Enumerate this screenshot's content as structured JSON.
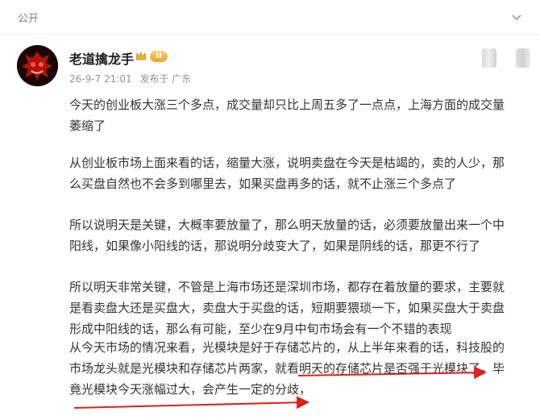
{
  "header": {
    "visibility_label": "公开",
    "menu_icon": "chevron-down-icon"
  },
  "post": {
    "author": {
      "name": "老道擒龙手",
      "badge_level": "II",
      "avatar_icon": "red-dragon-avatar"
    },
    "timestamp": "26-9-7 21:01",
    "location": "发布于 广东",
    "paragraphs": [
      [
        "今天的创业板大涨三个多点，成交量却只比上周五多了一点点，上海方面的成交量",
        "萎缩了"
      ],
      [
        "从创业板市场上面来看的话，缩量大涨，说明卖盘在今天是枯竭的，卖的人少，那",
        "么买盘自然也不会多到哪里去，如果买盘再多的话，就不止涨三个多点了"
      ],
      [
        "所以说明天是关键，大概率要放量了，那么明天放量的话，必须要放量出来一个中",
        "阳线，如果像小阳线的话，那说明分歧变大了，如果是阴线的话，那更不行了"
      ],
      [
        "所以明天非常关键，不管是上海市场还是深圳市场，都存在着放量的要求，主要就",
        "是看卖盘大还是买盘大，卖盘大于买盘的话，短期要猥琐一下，如果买盘大于卖盘",
        "形成中阳线的话，那么有可能，至少在9月中旬市场会有一个不错的表现"
      ],
      [
        "从今天市场的情况来看，光模块是好于存储芯片的，从上半年来看的话，科技股的",
        "市场龙头就是光模块和存储芯片两家，就看明天的存储芯片是否强于光模块了，毕",
        "竟光模块今天涨幅过大，会产生一定的分歧，"
      ]
    ]
  },
  "colors": {
    "accent_red": "#e0201a",
    "text": "#333333",
    "meta": "#939393"
  }
}
